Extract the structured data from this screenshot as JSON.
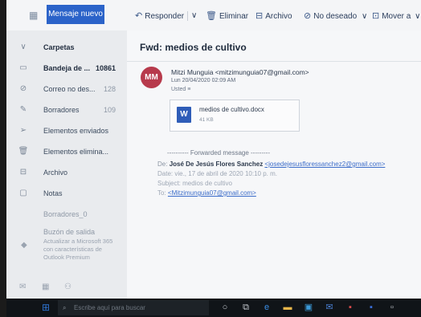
{
  "toolbar": {
    "new_message": "Mensaje nuevo",
    "reply": "Responder",
    "delete": "Eliminar",
    "archive": "Archivo",
    "junk": "No deseado",
    "move": "Mover a"
  },
  "nav": {
    "folders_header": "Carpetas",
    "items": [
      {
        "label": "Bandeja de ...",
        "count": "10861"
      },
      {
        "label": "Correo no des...",
        "count": "128"
      },
      {
        "label": "Borradores",
        "count": "109"
      },
      {
        "label": "Elementos enviados",
        "count": ""
      },
      {
        "label": "Elementos elimina...",
        "count": ""
      },
      {
        "label": "Archivo",
        "count": ""
      },
      {
        "label": "Notas",
        "count": ""
      },
      {
        "label": "Borradores_0",
        "count": ""
      },
      {
        "label": "Buzón de salida",
        "count": ""
      }
    ],
    "promo": "Actualizar a Microsoft 365 con características de Outlook Premium"
  },
  "message": {
    "subject": "Fwd: medios de cultivo",
    "avatar_initials": "MM",
    "from": "Mitzi Munguia <mitzimunguia07@gmail.com>",
    "date": "Lun 20/04/2020 02:09 AM",
    "to": "Usted ≡",
    "attachment": {
      "name": "medios de cultivo.docx",
      "size": "41 KB"
    },
    "forwarded_header": "---------- Forwarded message ---------",
    "fwd_from_label": "De:",
    "fwd_from_name": "José De Jesús Flores Sanchez",
    "fwd_from_email": "<josedejesusfloressanchez2@gmail.com>",
    "fwd_date": "Date: vie., 17 de abril de 2020 10:10 p. m.",
    "fwd_subject": "Subject: medios de cultivo",
    "fwd_to_label": "To:",
    "fwd_to_email": "<Mitzimunguia07@gmail.com>"
  },
  "taskbar": {
    "search_placeholder": "Escribe aquí para buscar"
  },
  "colors": {
    "accent": "#2b63c9",
    "avatar": "#b73a4c",
    "link": "#3b6cc9"
  }
}
